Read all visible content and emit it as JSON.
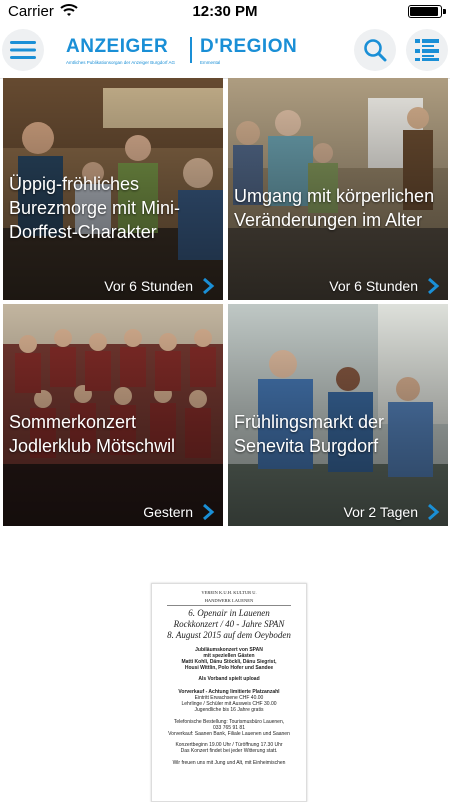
{
  "status_bar": {
    "carrier": "Carrier",
    "time": "12:30 PM",
    "battery_level": 1.0
  },
  "header": {
    "logo_left": "ANZEIGER",
    "logo_right": "D'REGION",
    "logo_left_sub": "Amtliches Publikationsorgan der Anzeiger Burgdorf AG",
    "logo_right_sub": "Emmental"
  },
  "articles": [
    {
      "title": "Üppig-fröhliches Burezmorge mit Mini-Dorffest-Charakter",
      "time": "Vor 6 Stunden"
    },
    {
      "title": "Umgang mit körperlichen Veränderungen im Alter",
      "time": "Vor 6 Stunden"
    },
    {
      "title": "Sommerkonzert Jodlerklub Mötschwil",
      "time": "Gestern"
    },
    {
      "title": "Frühlingsmarkt der Senevita Burgdorf",
      "time": "Vor 2 Tagen"
    }
  ],
  "ad": {
    "org_line1": "VEREIN K.U.H. KULTUR U.",
    "org_line2": "HANDWERK LAUENEN",
    "headline1": "6. Openair in Lauenen",
    "headline2": "Rockkonzert / 40 - Jahre SPAN",
    "headline3": "8. August 2015 auf dem Oeyboden",
    "lines": [
      "Jubiläumskonzert von SPAN",
      "mit speziellen Gästen",
      "Matti Kohli, Dänu Stöckli, Dänu Siegrist,",
      "Housi Wittlin, Polo Hofer und Sandee",
      "Als Vorband spielt upload",
      "Vorverkauf - Achtung limitierte Platzanzahl",
      "Eintritt Erwachsene CHF 40.00",
      "Lehrlinge / Schüler mit Ausweis CHF 30.00",
      "Jugendliche bis 16 Jahre gratis",
      "Telefonische Bestellung: Tourismusbüro Lauenen,",
      "033 765 91 81",
      "Vorverkauf: Saanen Bank, Filiale Lauenen und Saanen",
      "Konzertbeginn 19.00 Uhr / Türöffnung 17.30 Uhr",
      "Das Konzert findet bei jeder Witterung statt.",
      "Wir freuen uns mit Jung und Alt, mit Einheimischen"
    ]
  }
}
